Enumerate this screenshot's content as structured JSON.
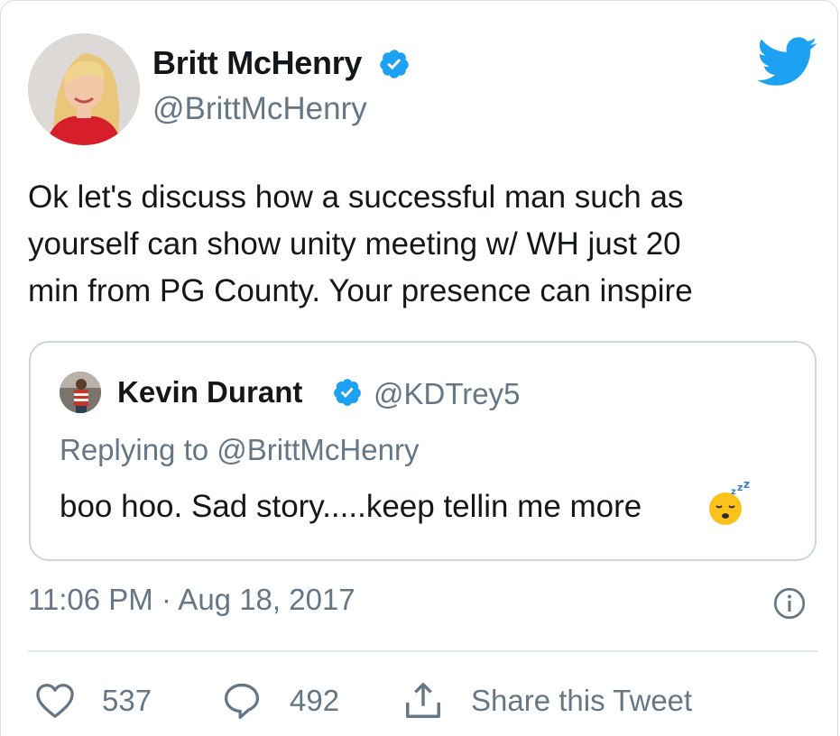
{
  "author": {
    "name": "Britt McHenry",
    "handle": "@BrittMcHenry",
    "verified": true
  },
  "tweet": {
    "lines": [
      "Ok let's discuss how a successful man such as",
      "yourself can show unity meeting w/ WH just 20",
      "min from PG County. Your presence can inspire"
    ],
    "timestamp": "11:06 PM · Aug 18, 2017"
  },
  "quoted": {
    "name": "Kevin Durant",
    "handle": "@KDTrey5",
    "verified": true,
    "replying_to": "Replying to @BrittMcHenry",
    "body": "boo hoo. Sad story.....keep tellin me more",
    "emoji": "sleeping-face"
  },
  "actions": {
    "likes": "537",
    "replies": "492",
    "share_label": "Share this Tweet"
  },
  "icons": {
    "logo": "twitter-bird-icon",
    "info": "info-icon",
    "like": "heart-icon",
    "reply": "reply-bubble-icon",
    "share": "share-icon"
  },
  "colors": {
    "brand": "#1da1f2",
    "text": "#14171a",
    "secondary": "#657786",
    "border": "#ccd6dd"
  }
}
